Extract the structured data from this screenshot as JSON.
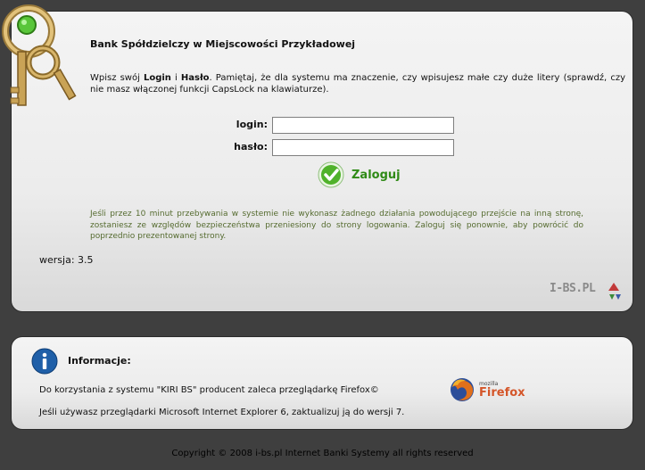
{
  "bank_title": "Bank Spółdzielczy w Miejscowości Przykładowej",
  "intro": {
    "part1": "Wpisz swój ",
    "login_word": "Login",
    "part2": " i ",
    "password_word": "Hasło",
    "part3": ". Pamiętaj, że dla systemu ma znaczenie, czy wpisujesz małe czy duże litery (sprawdź, czy nie masz włączonej funkcji CapsLock na klawiaturze)."
  },
  "form": {
    "login_label": "login:",
    "password_label": "hasło:",
    "login_value": "",
    "password_value": "",
    "submit_label": "Zaloguj"
  },
  "notice": "Jeśli przez 10 minut przebywania w systemie nie wykonasz żadnego działania powodującego przejście na inną stronę, zostaniesz ze względów bezpieczeństwa przeniesiony do strony logowania. Zaloguj się ponownie, aby powrócić do poprzednio prezentowanej strony.",
  "version": "wersja: 3.5",
  "logo_text": "I-BS.PL",
  "info": {
    "title": "Informacje:",
    "line1": "Do korzystania z systemu \"KIRI BS\" producent zaleca przeglądarkę Firefox©",
    "line2": "Jeśli używasz przeglądarki Microsoft Internet Explorer 6, zaktualizuj ją do wersji 7.",
    "firefox_small": "mozilla",
    "firefox_big": "Firefox"
  },
  "footer": "Copyright © 2008 i-bs.pl Internet Banki Systemy all rights reserved",
  "colors": {
    "background": "#3f3f3f",
    "notice_text": "#556b2f",
    "submit_text": "#2f8a16",
    "info_icon": "#1f5fa8"
  }
}
